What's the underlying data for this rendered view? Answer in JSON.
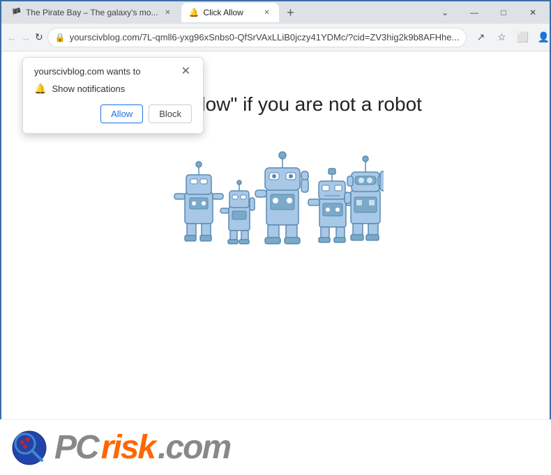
{
  "titleBar": {
    "tabs": [
      {
        "id": "tab1",
        "label": "The Pirate Bay – The galaxy's mo...",
        "active": false,
        "favicon": "🏴"
      },
      {
        "id": "tab2",
        "label": "Click Allow",
        "active": true,
        "favicon": "🔔"
      }
    ],
    "newTabLabel": "+",
    "windowControls": {
      "minimize": "—",
      "maximize": "□",
      "close": "✕"
    },
    "collapseIcon": "⋮"
  },
  "addressBar": {
    "back": "←",
    "forward": "→",
    "refresh": "↻",
    "url": "yourscivblog.com/7L-qmll6-yxg96xSnbs0-QfSrVAxLLiB0jczy41YDMc/?cid=ZV3hig2k9b8AFHhe...",
    "lockIcon": "🔒",
    "shareIcon": "↗",
    "starIcon": "☆",
    "extensionIcon": "⬜",
    "profileIcon": "👤",
    "menuIcon": "⋮"
  },
  "notificationPopup": {
    "title": "yourscivblog.com wants to",
    "closeLabel": "✕",
    "notificationRow": {
      "icon": "🔔",
      "label": "Show notifications"
    },
    "buttons": {
      "allow": "Allow",
      "block": "Block"
    }
  },
  "pageContent": {
    "mainText": "Click \"Allow\"  if you are not   a robot"
  },
  "footer": {
    "logoText": "PC",
    "riskText": "risk",
    "dotComText": ".com"
  }
}
